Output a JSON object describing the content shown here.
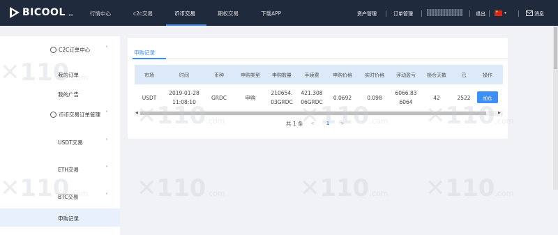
{
  "header": {
    "logo_text": "BICOOL",
    "logo_suffix": ".co",
    "nav": [
      "行情中心",
      "c2c交易",
      "币币交易",
      "期权交易",
      "下载APP"
    ],
    "active_nav": "币币交易",
    "right": {
      "asset_mgmt": "资产管理",
      "order_mgmt": "订单管理",
      "logout": "退出",
      "messages": "消息"
    }
  },
  "sidebar": {
    "group1": {
      "label": "C2C订单中心",
      "icon": "c2c-icon"
    },
    "group1_items": [
      "我的订单",
      "我的广告"
    ],
    "group2": {
      "label": "币币交易订单管理",
      "icon": "exchange-icon"
    },
    "group2_items": [
      "USDT交易",
      "ETH交易",
      "BTC交易",
      "申购记录"
    ],
    "active_item": "申购记录"
  },
  "tab": {
    "label": "申购记录"
  },
  "table": {
    "headers": [
      "市场",
      "时间",
      "币种",
      "申购类型",
      "申购数量",
      "手续费",
      "申购价格",
      "实时价格",
      "浮动盈亏",
      "锁仓天数",
      "已",
      "操作"
    ],
    "rows": [
      {
        "market": "USDT",
        "time_line1": "2019-01-28",
        "time_line2": "11:08:10",
        "currency": "GRDC",
        "type": "申购",
        "amount_line1": "210654.",
        "amount_line2": "03GRDC",
        "fee_line1": "421.308",
        "fee_line2": "06GRDC",
        "price": "0.0692",
        "realtime_price": "0.098",
        "pnl_line1": "6066.83",
        "pnl_line2": "6064",
        "lock_days": "42",
        "partial": "2522",
        "action": "加仓"
      }
    ]
  },
  "pagination": {
    "total_text": "共 1 条",
    "prev": "<",
    "page": "1",
    "next": ">"
  },
  "colors": {
    "topbar": "#1f2a3d",
    "accent": "#3d8ef5",
    "header_row": "#dbe9f8",
    "sidebar_active": "#e8f0fd"
  }
}
